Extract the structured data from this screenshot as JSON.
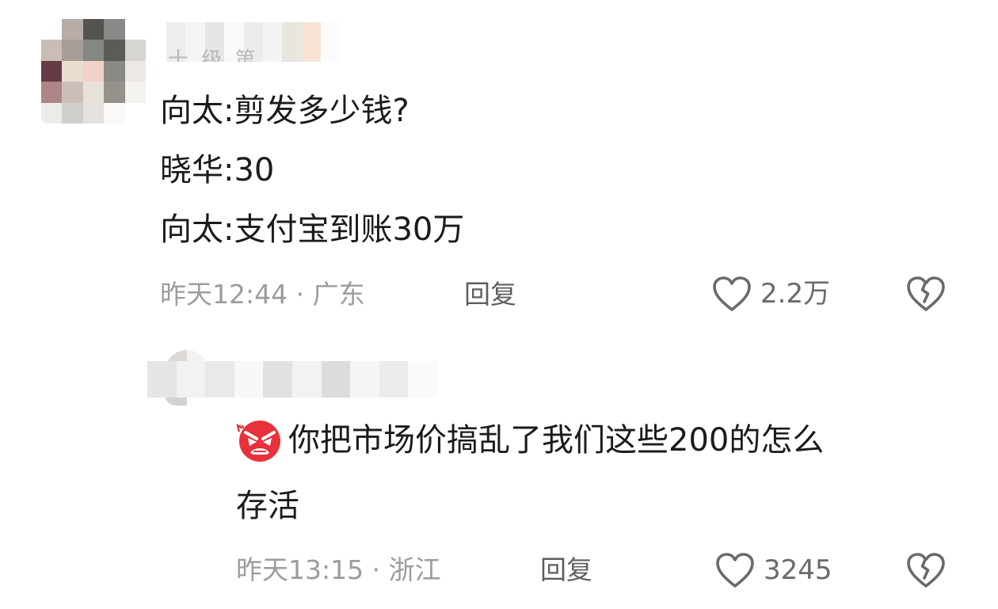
{
  "comment1": {
    "avatar_colors": [
      "#ffffff",
      "#b7aca7",
      "#54534f",
      "#8b8987",
      "#ffffff",
      "#c9bdb7",
      "#a79d97",
      "#858783",
      "#5a5c58",
      "#d7d5d1",
      "#633b45",
      "#e9ddd0",
      "#f1d2c6",
      "#898a84",
      "#ede9e5",
      "#ad8688",
      "#ccbebb",
      "#e7e1db",
      "#97918c",
      "#f5f3f0",
      "#ecebe8",
      "#d1cfcc",
      "#e5e1de",
      "#faf9f7",
      "#ffffff"
    ],
    "name_colors": [
      "#ededed",
      "#f5f5f5",
      "#e6e6e6",
      "#f9f9f9",
      "#ececec",
      "#f3f3f3",
      "#e9e5e0",
      "#f7e4d4",
      "#fbfbfb",
      "#ffffff"
    ],
    "cut_text": "十 级 第",
    "lines": [
      "向太:剪发多少钱?",
      "晓华:30",
      "向太:支付宝到账30万"
    ],
    "time": "昨天12:44",
    "location": "广东",
    "reply_label": "回复",
    "like_count": "2.2万",
    "like_icon": "heart-outline-icon",
    "dislike_icon": "broken-heart-icon"
  },
  "comment2": {
    "avatar_colors": [
      "#dddad3",
      "#f4f2ee",
      "#bfb8b1",
      "#f0efec",
      "#d3d1cd",
      "#ffffff"
    ],
    "name_colors": [
      "#e5e5e5",
      "#f2f2f2",
      "#e9e9e9",
      "#f8f8f8",
      "#e1e1e1",
      "#f2f2f2",
      "#dcdcdc",
      "#f5f5f5",
      "#ebebeb",
      "#fafafa"
    ],
    "emoji": "angry-face-icon",
    "lines": [
      "你把市场价搞乱了我们这些200的怎么",
      "存活"
    ],
    "time": "昨天13:15",
    "location": "浙江",
    "reply_label": "回复",
    "like_count": "3245",
    "like_icon": "heart-outline-icon",
    "dislike_icon": "broken-heart-icon"
  }
}
